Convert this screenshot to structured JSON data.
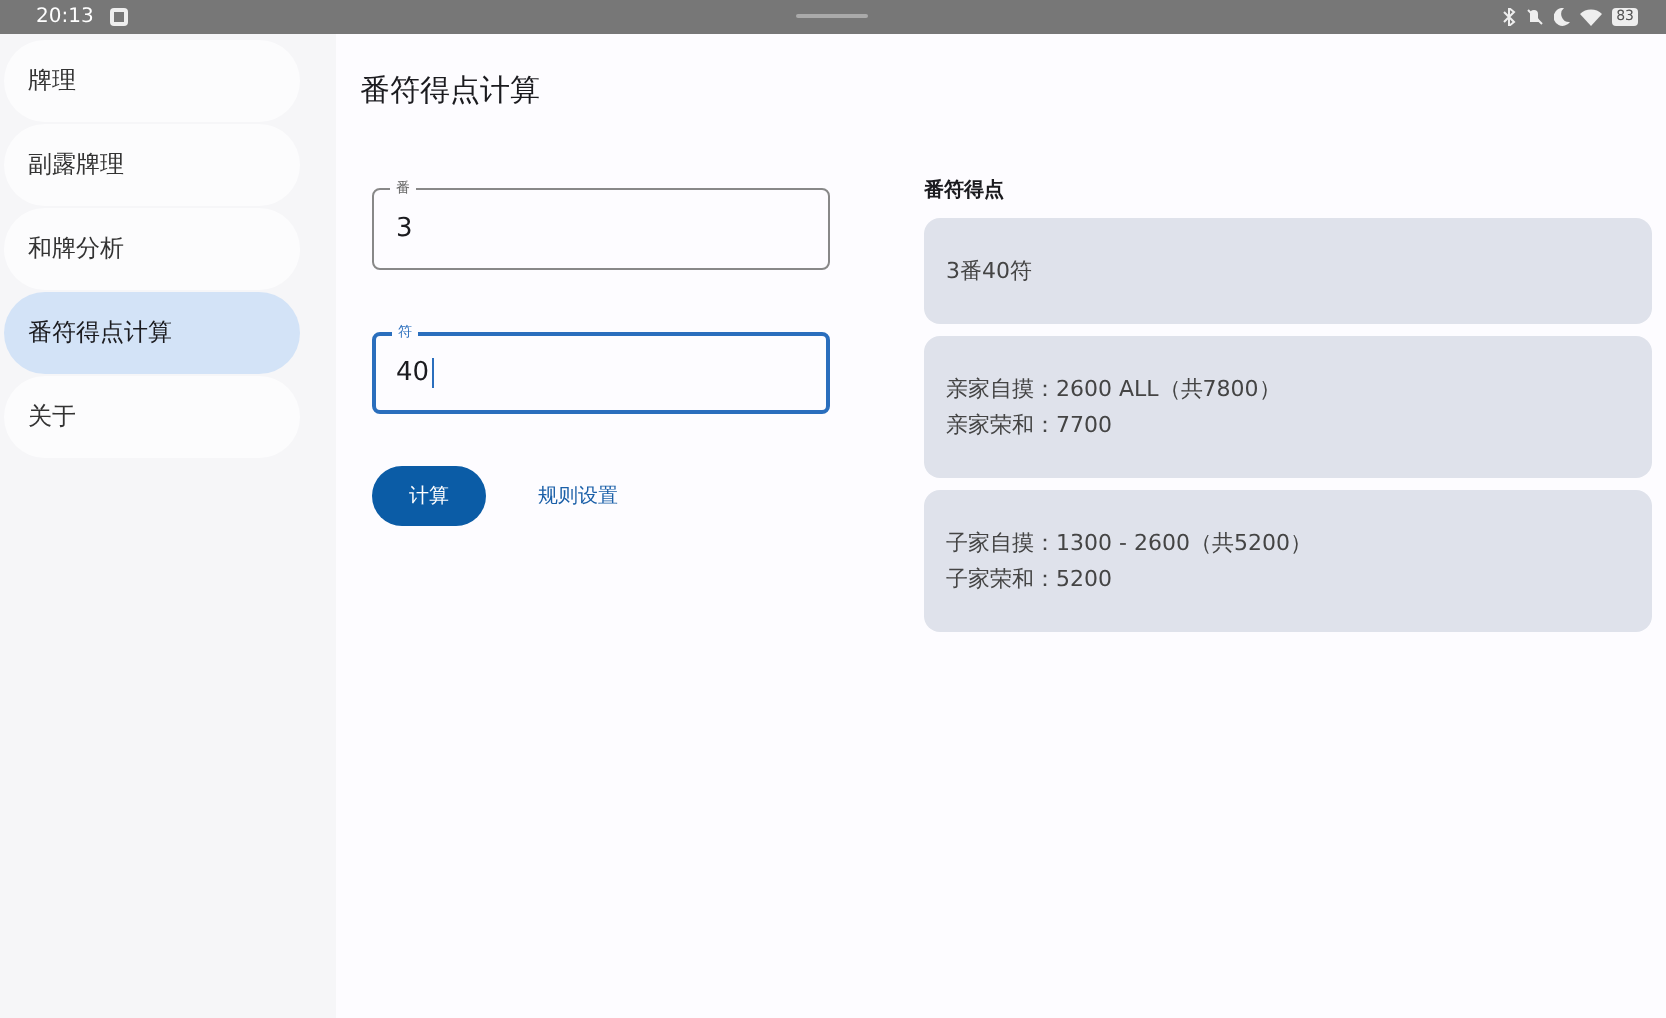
{
  "status_bar": {
    "time": "20:13",
    "battery": "83"
  },
  "sidebar": {
    "items": [
      {
        "label": "牌理",
        "selected": false
      },
      {
        "label": "副露牌理",
        "selected": false
      },
      {
        "label": "和牌分析",
        "selected": false
      },
      {
        "label": "番符得点计算",
        "selected": true
      },
      {
        "label": "关于",
        "selected": false
      }
    ]
  },
  "page_title": "番符得点计算",
  "fields": [
    {
      "label": "番",
      "value": "3",
      "focused": false
    },
    {
      "label": "符",
      "value": "40",
      "focused": true
    }
  ],
  "buttons": {
    "primary": "计算",
    "link": "规则设置"
  },
  "result": {
    "title": "番符得点",
    "cards": [
      {
        "lines": [
          "3番40符"
        ]
      },
      {
        "lines": [
          "亲家自摸：2600 ALL（共7800）",
          "亲家荣和：7700"
        ]
      },
      {
        "lines": [
          "子家自摸：1300 - 2600（共5200）",
          "子家荣和：5200"
        ]
      }
    ]
  }
}
